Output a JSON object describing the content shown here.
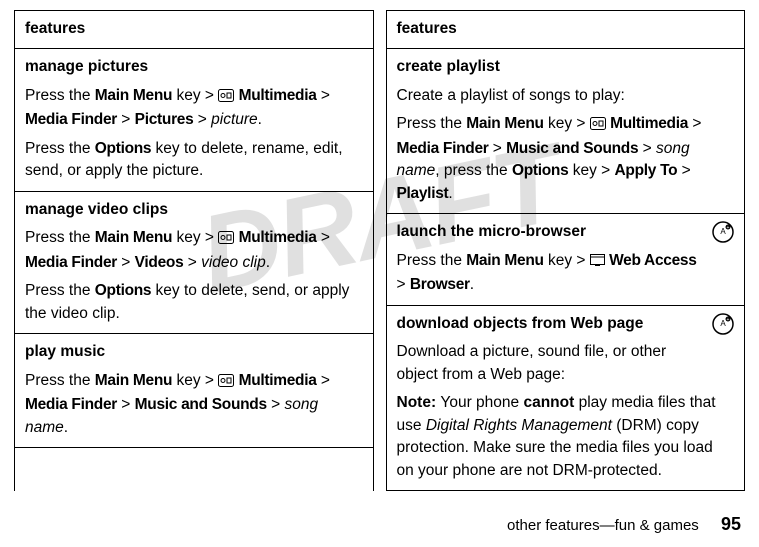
{
  "watermark": "DRAFT",
  "left": {
    "header": "features",
    "cells": [
      {
        "title": "manage pictures",
        "p1_pre": "Press the ",
        "p1_mm": "Main Menu",
        "p1_mid1": " key > ",
        "p1_multi": "Multimedia",
        "p1_gt1": " > ",
        "p1_mf": "Media Finder",
        "p1_gt2": " > ",
        "p1_pics": "Pictures",
        "p1_gt3": " > ",
        "p1_it": "picture",
        "p1_end": ".",
        "p2_pre": "Press the ",
        "p2_opt": "Options",
        "p2_end": " key to delete, rename, edit, send, or apply the picture."
      },
      {
        "title": "manage video clips",
        "p1_pre": "Press the ",
        "p1_mm": "Main Menu",
        "p1_mid1": " key > ",
        "p1_multi": "Multimedia",
        "p1_gt1": " > ",
        "p1_mf": "Media Finder",
        "p1_gt2": " > ",
        "p1_vid": "Videos",
        "p1_gt3": " > ",
        "p1_it": "video clip",
        "p1_end": ".",
        "p2_pre": "Press the ",
        "p2_opt": "Options",
        "p2_end": " key to delete, send, or apply the video clip."
      },
      {
        "title": "play music",
        "p1_pre": "Press the ",
        "p1_mm": "Main Menu",
        "p1_mid1": " key > ",
        "p1_multi": "Multimedia",
        "p1_gt1": " > ",
        "p1_mf": "Media Finder",
        "p1_gt2": " > ",
        "p1_ms": "Music and Sounds",
        "p1_gt3": " > ",
        "p1_it": "song name",
        "p1_end": "."
      }
    ]
  },
  "right": {
    "header": "features",
    "cells": [
      {
        "title": "create playlist",
        "intro": "Create a playlist of songs to play:",
        "p1_pre": "Press the ",
        "p1_mm": "Main Menu",
        "p1_mid1": " key > ",
        "p1_multi": "Multimedia",
        "p1_gt1": " > ",
        "p1_mf": "Media Finder",
        "p1_gt2": " > ",
        "p1_ms": "Music and Sounds",
        "p1_gt3": " > ",
        "p1_it": "song name",
        "p1_comma": ", press the ",
        "p1_opt": "Options",
        "p1_mid2": " key > ",
        "p1_at": "Apply To",
        "p1_gt4": " > ",
        "p1_pl": "Playlist",
        "p1_end": "."
      },
      {
        "title": "launch the micro-browser",
        "p1_pre": "Press the ",
        "p1_mm": "Main Menu",
        "p1_mid1": " key > ",
        "p1_wa": "Web Access",
        "p1_gt1": " > ",
        "p1_br": "Browser",
        "p1_end": "."
      },
      {
        "title": "download objects from Web page",
        "intro": "Download a picture, sound file, or other object from a Web page:",
        "note_lbl": "Note: ",
        "note_a": "Your phone ",
        "note_cannot": "cannot",
        "note_b": " play media files that use ",
        "note_drm": "Digital Rights Management",
        "note_c": " (DRM) copy protection. Make sure the media files you load on your phone are not DRM-protected."
      }
    ]
  },
  "footer": {
    "section": "other features—fun & games",
    "page": "95"
  }
}
